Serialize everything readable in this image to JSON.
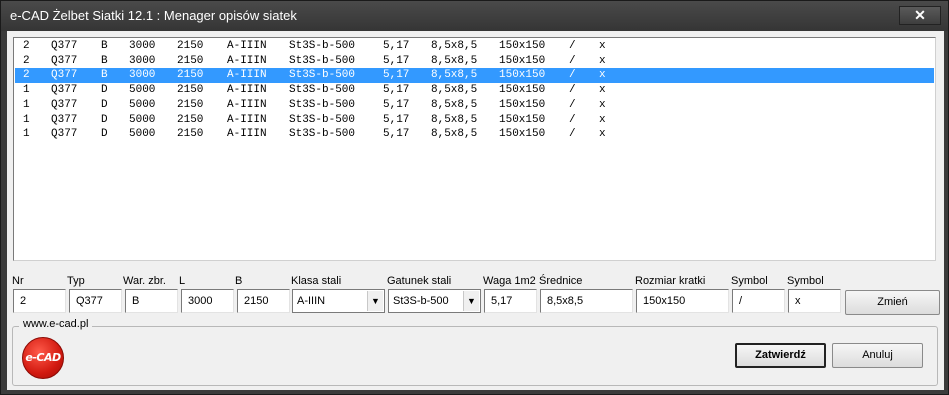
{
  "window": {
    "title": "e-CAD Żelbet Siatki 12.1 : Menager opisów siatek",
    "close_glyph": "✕"
  },
  "list": {
    "selected_index": 2,
    "rows": [
      [
        "2",
        "Q377",
        "B",
        "3000",
        "2150",
        "A-IIIN",
        "St3S-b-500",
        "5,17",
        "8,5x8,5",
        "150x150",
        "/",
        "x"
      ],
      [
        "2",
        "Q377",
        "B",
        "3000",
        "2150",
        "A-IIIN",
        "St3S-b-500",
        "5,17",
        "8,5x8,5",
        "150x150",
        "/",
        "x"
      ],
      [
        "2",
        "Q377",
        "B",
        "3000",
        "2150",
        "A-IIIN",
        "St3S-b-500",
        "5,17",
        "8,5x8,5",
        "150x150",
        "/",
        "x"
      ],
      [
        "1",
        "Q377",
        "D",
        "5000",
        "2150",
        "A-IIIN",
        "St3S-b-500",
        "5,17",
        "8,5x8,5",
        "150x150",
        "/",
        "x"
      ],
      [
        "1",
        "Q377",
        "D",
        "5000",
        "2150",
        "A-IIIN",
        "St3S-b-500",
        "5,17",
        "8,5x8,5",
        "150x150",
        "/",
        "x"
      ],
      [
        "1",
        "Q377",
        "D",
        "5000",
        "2150",
        "A-IIIN",
        "St3S-b-500",
        "5,17",
        "8,5x8,5",
        "150x150",
        "/",
        "x"
      ],
      [
        "1",
        "Q377",
        "D",
        "5000",
        "2150",
        "A-IIIN",
        "St3S-b-500",
        "5,17",
        "8,5x8,5",
        "150x150",
        "/",
        "x"
      ]
    ]
  },
  "editor": {
    "labels": {
      "nr": "Nr",
      "typ": "Typ",
      "war_zbr": "War. zbr.",
      "l": "L",
      "b": "B",
      "klasa_stali": "Klasa stali",
      "gatunek_stali": "Gatunek stali",
      "waga": "Waga 1m2",
      "srednice": "Średnice",
      "rozmiar_kratki": "Rozmiar kratki",
      "symbol1": "Symbol",
      "symbol2": "Symbol"
    },
    "values": {
      "nr": "2",
      "typ": "Q377",
      "war_zbr": "B",
      "l": "3000",
      "b": "2150",
      "klasa_stali": "A-IIIN",
      "gatunek_stali": "St3S-b-500",
      "waga": "5,17",
      "srednice": "8,5x8,5",
      "rozmiar_kratki": "150x150",
      "symbol1": "/",
      "symbol2": "x"
    },
    "change_button": "Zmień"
  },
  "footer": {
    "group_label": "www.e-cad.pl",
    "logo_text": "e-CAD",
    "confirm_button": "Zatwierdź",
    "cancel_button": "Anuluj"
  },
  "colors": {
    "selection": "#3399ff",
    "titlebar": "#3b3b3b",
    "logo": "#d21a10"
  }
}
